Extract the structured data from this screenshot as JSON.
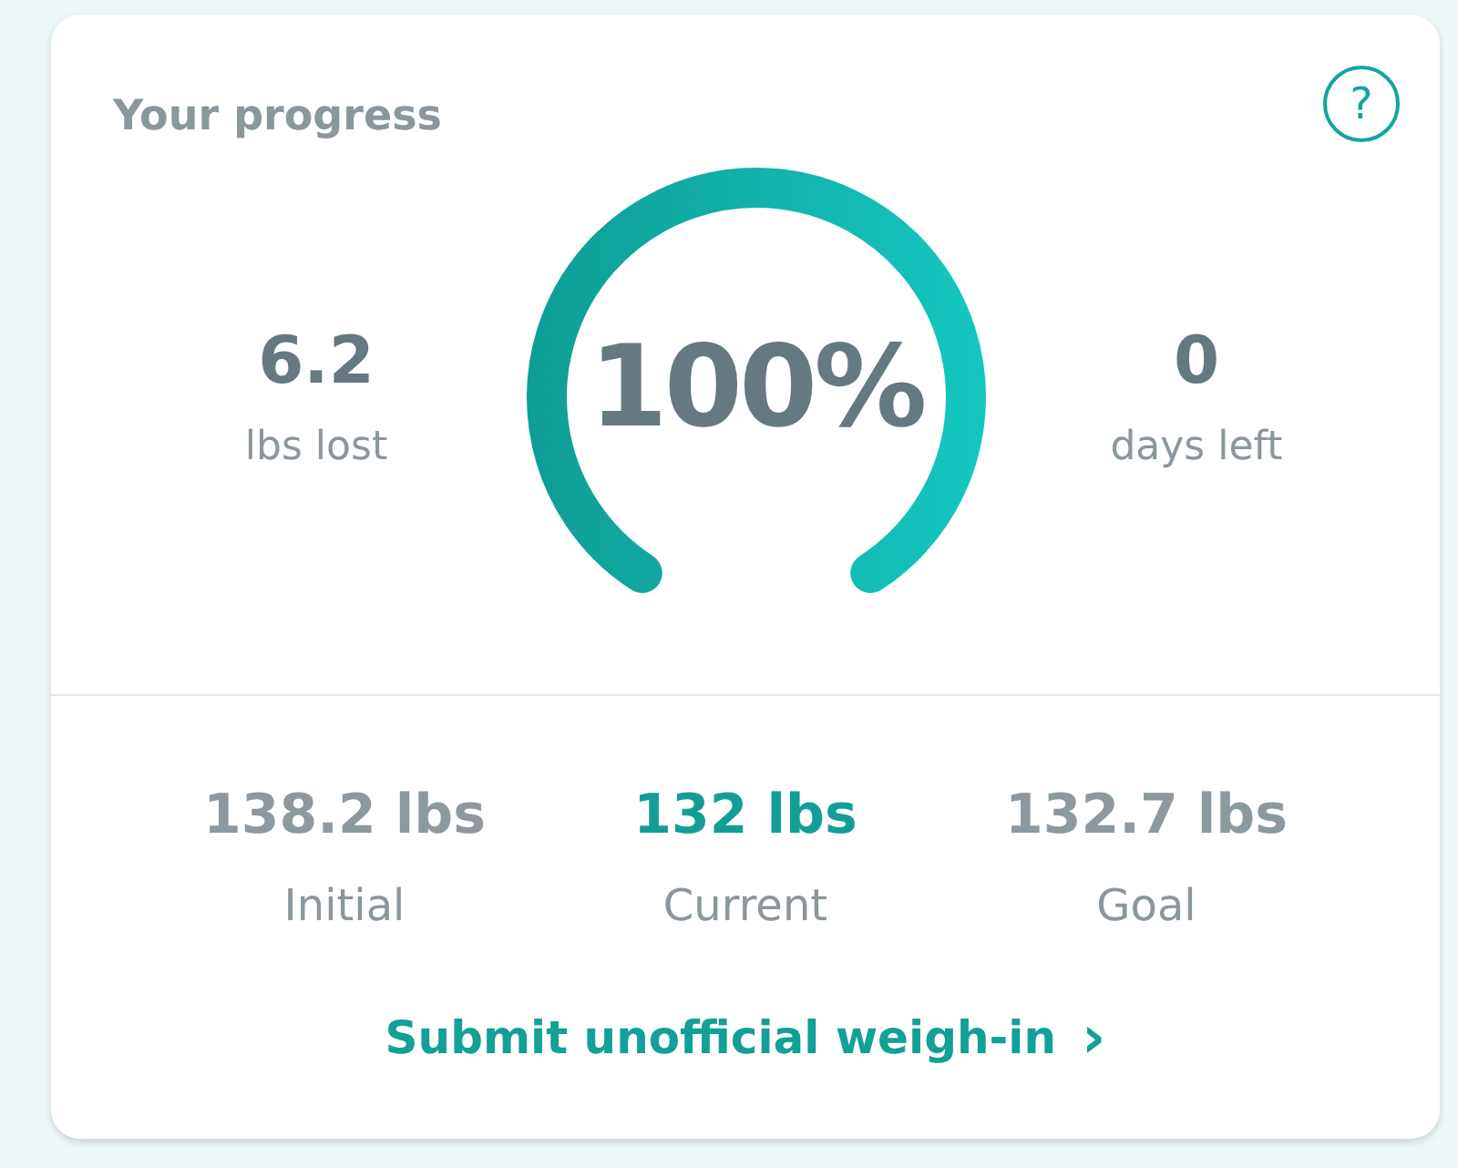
{
  "title": "Your progress",
  "help_icon": "?",
  "left_stat": {
    "value": "6.2",
    "label": "lbs lost"
  },
  "gauge": {
    "reading": "100%"
  },
  "right_stat": {
    "value": "0",
    "label": "days left"
  },
  "weights": [
    {
      "value": "138.2 lbs",
      "label": "Initial",
      "highlight": false
    },
    {
      "value": "132 lbs",
      "label": "Current",
      "highlight": true
    },
    {
      "value": "132.7 lbs",
      "label": "Goal",
      "highlight": false
    }
  ],
  "link": {
    "label": "Submit unofficial weigh-in",
    "arrow": "›"
  }
}
